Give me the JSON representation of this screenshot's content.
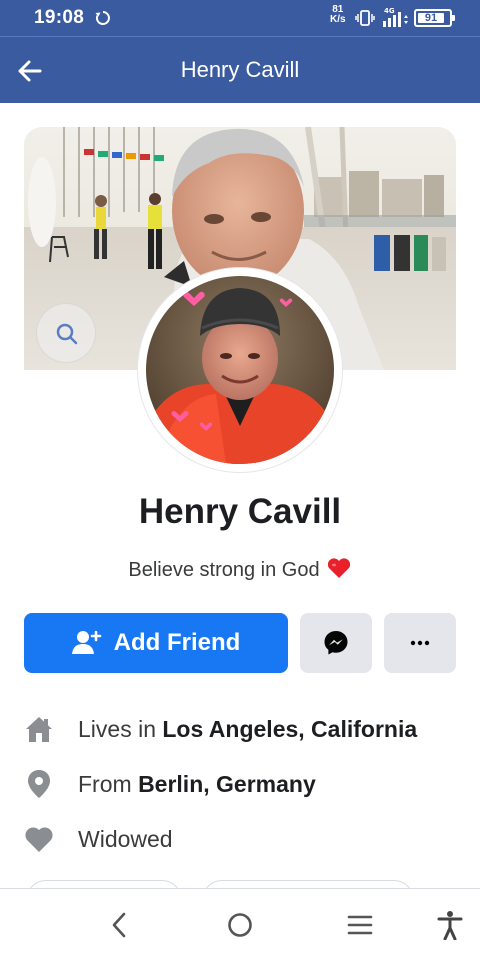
{
  "status_bar": {
    "time": "19:08",
    "speed_value": "81",
    "speed_unit": "K/s",
    "network": "4G",
    "battery": "91"
  },
  "header": {
    "title": "Henry Cavill",
    "back_icon": "arrow-left-icon"
  },
  "cover": {
    "search_icon": "search-icon"
  },
  "profile": {
    "name": "Henry Cavill",
    "bio": "Believe strong in God",
    "bio_emoji": "red-heart-icon"
  },
  "actions": {
    "add_friend_label": "Add Friend",
    "add_friend_icon": "person-add-icon",
    "messenger_icon": "messenger-icon",
    "more_icon": "more-dots-icon"
  },
  "details": {
    "lives_prefix": "Lives in ",
    "lives_value": "Los Angeles, California",
    "from_prefix": "From ",
    "from_value": "Berlin, Germany",
    "relationship": "Widowed"
  },
  "colors": {
    "header_bg": "#3b5ba0",
    "primary": "#1877f2",
    "secondary_btn": "#e4e6eb",
    "icon_gray": "#8a8d91"
  },
  "bottom_nav": {
    "items": [
      "back-nav-icon",
      "home-nav-icon",
      "recents-nav-icon",
      "accessibility-icon"
    ]
  }
}
